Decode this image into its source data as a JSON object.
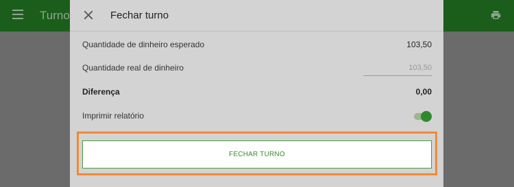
{
  "appbar": {
    "title": "Turno",
    "menu_icon": "menu-icon",
    "print_icon": "print-icon"
  },
  "dialog": {
    "title": "Fechar turno",
    "close_icon": "close-icon",
    "rows": {
      "expected_label": "Quantidade de dinheiro esperado",
      "expected_value": "103,50",
      "actual_label": "Quantidade real de dinheiro",
      "actual_placeholder": "103,50",
      "difference_label": "Diferença",
      "difference_value": "0,00",
      "print_label": "Imprimir relatório",
      "print_enabled": true
    },
    "button_label": "FECHAR TURNO"
  },
  "colors": {
    "accent_green": "#2f8a2f",
    "highlight_orange": "#f08a34"
  }
}
